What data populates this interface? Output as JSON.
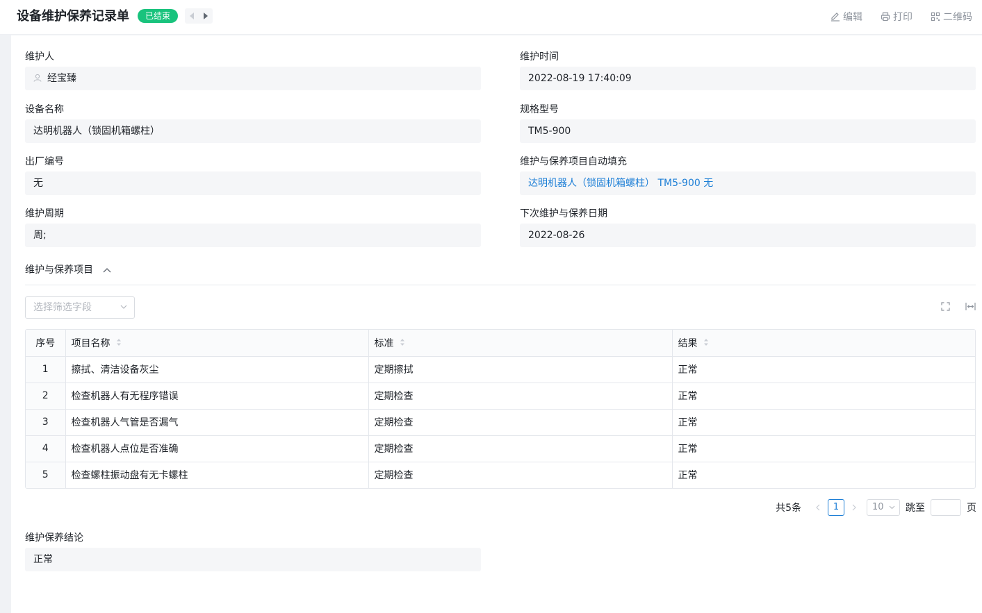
{
  "header": {
    "title": "设备维护保养记录单",
    "status": "已结束",
    "actions": {
      "edit": "编辑",
      "print": "打印",
      "qrcode": "二维码"
    }
  },
  "fields": {
    "maintainer": {
      "label": "维护人",
      "value": "经宝臻"
    },
    "maintain_time": {
      "label": "维护时间",
      "value": "2022-08-19 17:40:09"
    },
    "device_name": {
      "label": "设备名称",
      "value": "达明机器人（锁固机箱螺柱）"
    },
    "model": {
      "label": "规格型号",
      "value": "TM5-900"
    },
    "serial_no": {
      "label": "出厂编号",
      "value": "无"
    },
    "autofill": {
      "label": "维护与保养项目自动填充",
      "value": "达明机器人（锁固机箱螺柱） TM5-900 无"
    },
    "cycle": {
      "label": "维护周期",
      "value": "周;"
    },
    "next_date": {
      "label": "下次维护与保养日期",
      "value": "2022-08-26"
    },
    "conclusion": {
      "label": "维护保养结论",
      "value": "正常"
    }
  },
  "section": {
    "title": "维护与保养项目"
  },
  "filter": {
    "placeholder": "选择筛选字段"
  },
  "table": {
    "columns": [
      "序号",
      "项目名称",
      "标准",
      "结果"
    ],
    "rows": [
      [
        "1",
        "擦拭、清洁设备灰尘",
        "定期擦拭",
        "正常"
      ],
      [
        "2",
        "检查机器人有无程序错误",
        "定期检查",
        "正常"
      ],
      [
        "3",
        "检查机器人气管是否漏气",
        "定期检查",
        "正常"
      ],
      [
        "4",
        "检查机器人点位是否准确",
        "定期检查",
        "正常"
      ],
      [
        "5",
        "检查螺柱振动盘有无卡螺柱",
        "定期检查",
        "正常"
      ]
    ]
  },
  "pagination": {
    "total": "共5条",
    "current": "1",
    "page_size": "10",
    "goto_label": "跳至",
    "page_unit": "页"
  },
  "colors": {
    "accent": "#1c7ed6",
    "status": "#19c37d"
  },
  "icons": [
    "edit-icon",
    "print-icon",
    "qrcode-icon",
    "user-icon",
    "chevron-up-icon",
    "chevron-down-icon",
    "fullscreen-icon",
    "column-width-icon",
    "sort-icon"
  ]
}
